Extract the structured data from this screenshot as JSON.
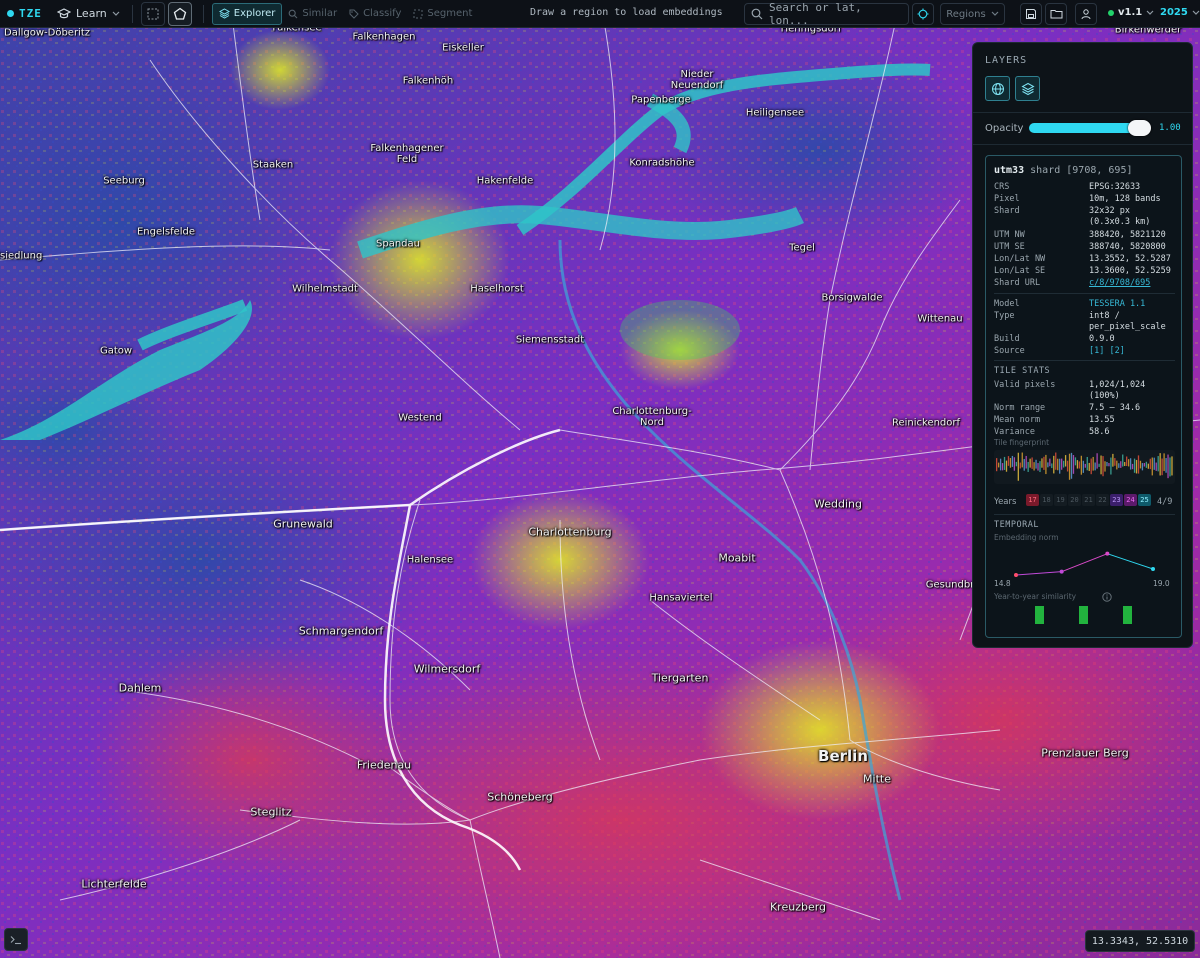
{
  "app": {
    "logo": "TZE",
    "learn_label": "Learn"
  },
  "toolbar": {
    "modes": [
      "Explorer",
      "Similar",
      "Classify",
      "Segment"
    ],
    "hint": "Draw a region to load embeddings",
    "search_placeholder": "Search or lat, lon...",
    "regions_label": "Regions",
    "version": "v1.1",
    "year": "2025"
  },
  "map": {
    "labels": [
      {
        "text": "Dallgow-Döberitz",
        "kind": "place"
      },
      {
        "text": "Falkensee",
        "kind": "place"
      },
      {
        "text": "Falkenhagen",
        "kind": "place"
      },
      {
        "text": "Eiskeller",
        "kind": "place"
      },
      {
        "text": "Falkenhöh",
        "kind": "place"
      },
      {
        "text": "Hennigsdorf",
        "kind": "place"
      },
      {
        "text": "Birkenwerder",
        "kind": "place"
      },
      {
        "text": "Nieder Neuendorf",
        "kind": "place"
      },
      {
        "text": "Papenberge",
        "kind": "place"
      },
      {
        "text": "Heiligensee",
        "kind": "place"
      },
      {
        "text": "Konradshöhe",
        "kind": "place"
      },
      {
        "text": "Falkenhagener Feld",
        "kind": "place"
      },
      {
        "text": "Staaken",
        "kind": "place"
      },
      {
        "text": "Seeburg",
        "kind": "place"
      },
      {
        "text": "Hakenfelde",
        "kind": "place"
      },
      {
        "text": "Engelsfelde",
        "kind": "place"
      },
      {
        "text": "Spandau",
        "kind": "place"
      },
      {
        "text": "Tegel",
        "kind": "place"
      },
      {
        "text": "dsiedlung",
        "kind": "place"
      },
      {
        "text": "Wilhelmstadt",
        "kind": "place"
      },
      {
        "text": "Haselhorst",
        "kind": "place"
      },
      {
        "text": "Borsigwalde",
        "kind": "place"
      },
      {
        "text": "Wittenau",
        "kind": "place"
      },
      {
        "text": "Gatow",
        "kind": "place"
      },
      {
        "text": "Siemensstadt",
        "kind": "place"
      },
      {
        "text": "Westend",
        "kind": "place"
      },
      {
        "text": "Charlottenburg-Nord",
        "kind": "place"
      },
      {
        "text": "Reinickendorf",
        "kind": "place"
      },
      {
        "text": "Grunewald",
        "kind": "district"
      },
      {
        "text": "Wedding",
        "kind": "district"
      },
      {
        "text": "Charlottenburg",
        "kind": "district"
      },
      {
        "text": "Halensee",
        "kind": "place"
      },
      {
        "text": "Moabit",
        "kind": "district"
      },
      {
        "text": "Hansaviertel",
        "kind": "place"
      },
      {
        "text": "Gesundbr",
        "kind": "place"
      },
      {
        "text": "Schmargendorf",
        "kind": "district"
      },
      {
        "text": "Wilmersdorf",
        "kind": "district"
      },
      {
        "text": "Tiergarten",
        "kind": "district"
      },
      {
        "text": "Dahlem",
        "kind": "district"
      },
      {
        "text": "Berlin",
        "kind": "city"
      },
      {
        "text": "Prenzlauer Berg",
        "kind": "district"
      },
      {
        "text": "Mitte",
        "kind": "district"
      },
      {
        "text": "Friedenau",
        "kind": "district"
      },
      {
        "text": "Steglitz",
        "kind": "district"
      },
      {
        "text": "Schöneberg",
        "kind": "district"
      },
      {
        "text": "Lichterfelde",
        "kind": "district"
      },
      {
        "text": "Kreuzberg",
        "kind": "district"
      }
    ]
  },
  "panel": {
    "title": "LAYERS",
    "opacity_label": "Opacity",
    "opacity_value": "1.00",
    "opacity_fraction": 1.0,
    "shard": {
      "zone": "utm33",
      "id": "shard [9708, 695]",
      "crs": {
        "k": "CRS",
        "v": "EPSG:32633"
      },
      "pixel": {
        "k": "Pixel",
        "v": "10m, 128 bands"
      },
      "shard_size": {
        "k": "Shard",
        "v1": "32x32 px",
        "v2": "(0.3x0.3 km)"
      },
      "utm_nw": {
        "k": "UTM NW",
        "v": "388420, 5821120"
      },
      "utm_se": {
        "k": "UTM SE",
        "v": "388740, 5820800"
      },
      "ll_nw": {
        "k": "Lon/Lat NW",
        "v": "13.3552, 52.5287"
      },
      "ll_se": {
        "k": "Lon/Lat SE",
        "v": "13.3600, 52.5259"
      },
      "url": {
        "k": "Shard URL",
        "v": "c/8/9708/695"
      },
      "model": {
        "k": "Model",
        "v": "TESSERA 1.1"
      },
      "type": {
        "k": "Type",
        "v1": "int8 /",
        "v2": "per_pixel_scale"
      },
      "build": {
        "k": "Build",
        "v": "0.9.0"
      },
      "source": {
        "k": "Source",
        "v": "[1] [2]"
      }
    },
    "tile_stats": {
      "title": "TILE STATS",
      "valid": {
        "k": "Valid pixels",
        "v1": "1,024/1,024",
        "v2": "(100%)"
      },
      "norm_range": {
        "k": "Norm range",
        "v": "7.5 – 34.6"
      },
      "mean_norm": {
        "k": "Mean norm",
        "v": "13.55"
      },
      "variance": {
        "k": "Variance",
        "v": "58.6"
      },
      "fingerprint_label": "Tile fingerprint"
    },
    "years": {
      "label": "Years",
      "items": [
        "17",
        "18",
        "19",
        "20",
        "21",
        "22",
        "23",
        "24",
        "25"
      ],
      "count": "4/9"
    },
    "temporal": {
      "title": "TEMPORAL",
      "embedding_label": "Embedding norm",
      "min_label": "14.8",
      "max_label": "19.0",
      "similarity_label": "Year-to-year similarity",
      "chart_data": {
        "type": "line",
        "x": [
          "17",
          "23",
          "24",
          "25"
        ],
        "values": [
          15.4,
          15.9,
          18.6,
          16.3
        ],
        "ylim": [
          14.8,
          19.0
        ]
      }
    }
  },
  "status": {
    "coords": "13.3343, 52.5310"
  },
  "colors": {
    "accent": "#2fd8f0",
    "panel_bg": "#0d1318",
    "topbar_bg": "#0d1117"
  }
}
